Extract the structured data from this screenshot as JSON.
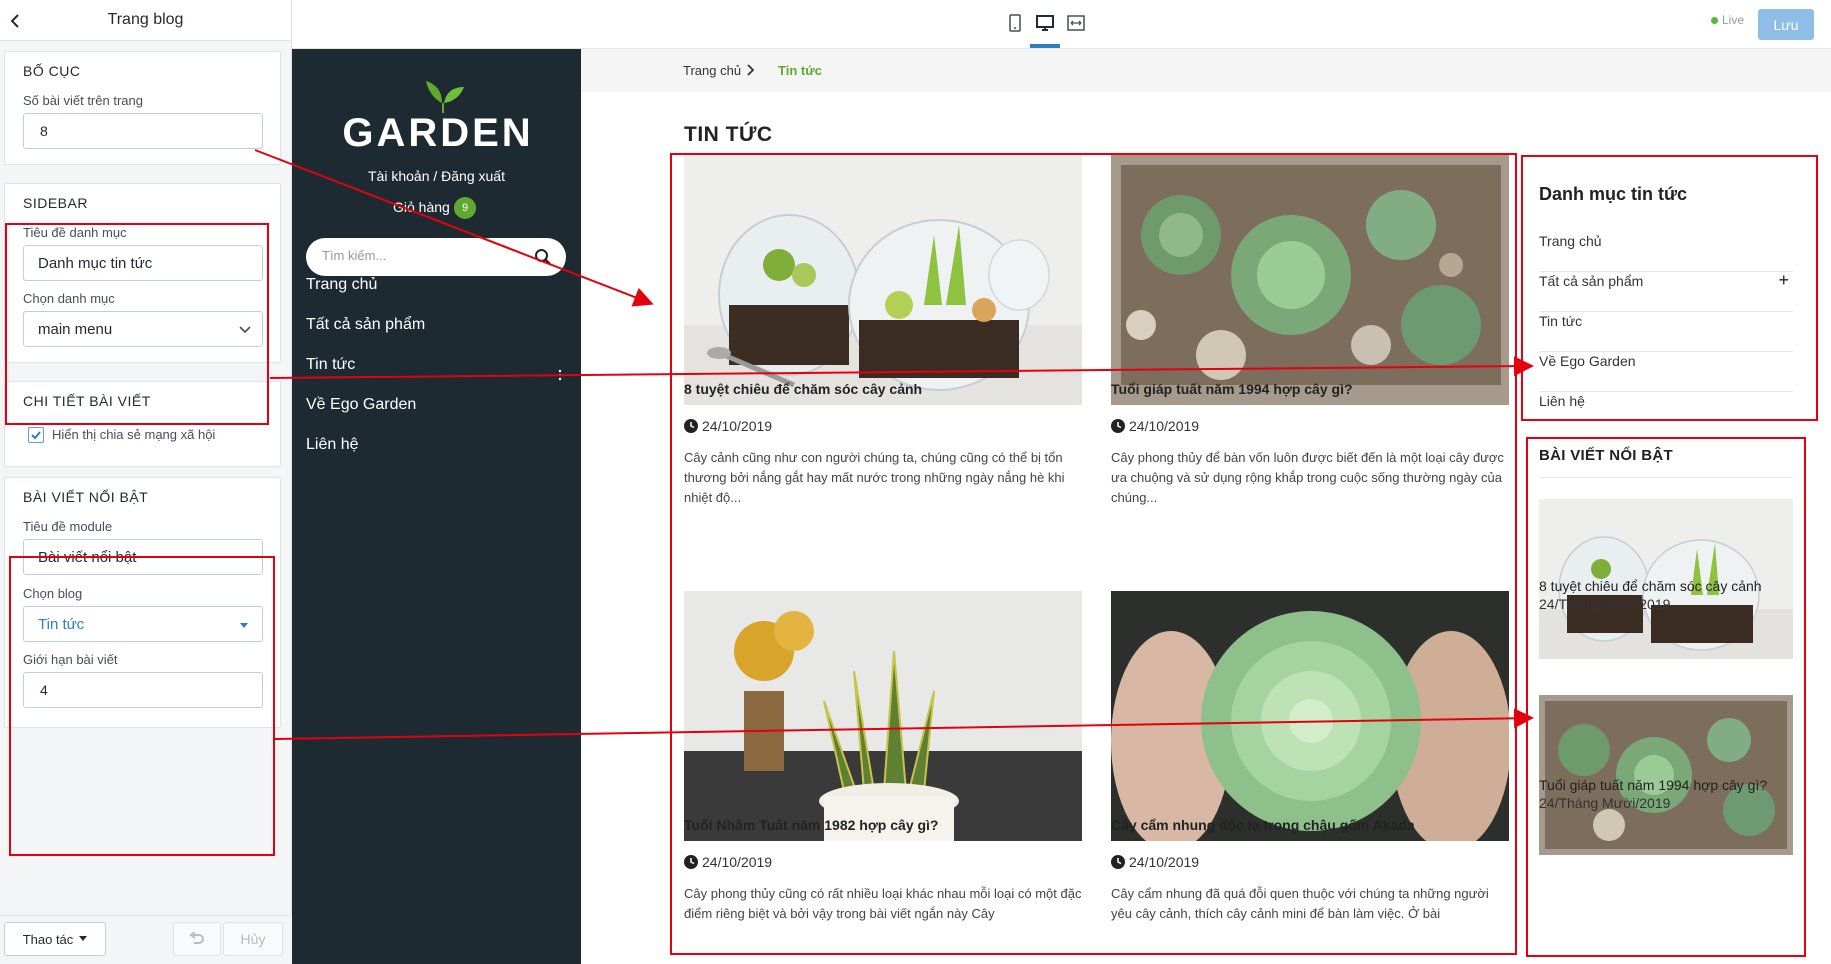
{
  "panel": {
    "title": "Trang blog",
    "layout": {
      "title": "BỐ CỤC",
      "posts_per_page_label": "Số bài viết trên trang",
      "posts_per_page_value": "8"
    },
    "sidebar": {
      "title": "SIDEBAR",
      "category_title_label": "Tiêu đề danh mục",
      "category_title_value": "Danh mục tin tức",
      "choose_category_label": "Chọn danh mục",
      "choose_category_value": "main menu"
    },
    "post_detail": {
      "title": "CHI TIẾT BÀI VIẾT",
      "share_label": "Hiển thị chia sẻ mạng xã hội"
    },
    "featured": {
      "title": "BÀI VIẾT NỔI BẬT",
      "module_title_label": "Tiêu đề module",
      "module_title_value": "Bài viết nổi bật",
      "choose_blog_label": "Chọn blog",
      "choose_blog_value": "Tin tức",
      "limit_label": "Giới hạn bài viết",
      "limit_value": "4"
    },
    "footer": {
      "actions_label": "Thao tác",
      "cancel_label": "Hủy"
    }
  },
  "topbar": {
    "live_label": "Live",
    "save_label": "Lưu"
  },
  "store": {
    "logo_text": "GARDEN",
    "account_links": "Tài khoản / Đăng xuất",
    "cart_label": "Giỏ hàng",
    "cart_count": "9",
    "search_placeholder": "Tìm kiếm...",
    "nav": [
      "Trang chủ",
      "Tất cả sản phẩm",
      "Tin tức",
      "Về Ego Garden",
      "Liên hệ"
    ]
  },
  "page": {
    "breadcrumb_home": "Trang chủ",
    "breadcrumb_current": "Tin tức",
    "heading": "TIN TỨC",
    "posts": [
      {
        "title": "8 tuyệt chiêu để chăm sóc cây cảnh",
        "date": "24/10/2019",
        "excerpt": "Cây cảnh cũng như con người chúng ta, chúng cũng có thể bị tổn thương bởi nắng gắt hay mất nước trong những ngày nắng hè khi nhiệt độ..."
      },
      {
        "title": "Tuổi giáp tuất năm 1994 hợp cây gì?",
        "date": "24/10/2019",
        "excerpt": "Cây phong thủy để bàn vốn luôn được biết đến là một loại cây được ưa chuộng và sử dụng rộng khắp trong cuộc sống thường ngày của chúng..."
      },
      {
        "title": "Tuổi Nhâm Tuất năm 1982 hợp cây gì?",
        "date": "24/10/2019",
        "excerpt": "Cây phong thủy cũng có rất nhiều loại khác nhau mỗi loại có một đặc điểm riêng biệt và bởi vậy trong bài viết ngắn này Cây"
      },
      {
        "title": "Cây cẩm nhung độc lạ trong chậu gốm Akada",
        "date": "24/10/2019",
        "excerpt": "Cây cẩm nhung đã quá đỗi quen thuộc với chúng ta những người yêu cây cảnh, thích cây cảnh mini để bàn làm việc. Ở bài"
      }
    ],
    "sidebar_title": "Danh mục tin tức",
    "sidebar_categories": [
      "Trang chủ",
      "Tất cả sản phẩm",
      "Tin tức",
      "Về Ego Garden",
      "Liên hệ"
    ],
    "featured_title": "BÀI VIẾT NỔI BẬT",
    "featured": [
      {
        "title": "8 tuyệt chiêu để chăm sóc cây cảnh",
        "date": "24/Tháng Mười/2019"
      },
      {
        "title": "Tuổi giáp tuất năm 1994 hợp cây gì?",
        "date": "24/Tháng Mười/2019"
      }
    ]
  },
  "colors": {
    "accent_blue": "#2d7fc1",
    "brand_green": "#5fa930",
    "sidebar_dark": "#1e2a32",
    "annotation_red": "#e3000f"
  }
}
